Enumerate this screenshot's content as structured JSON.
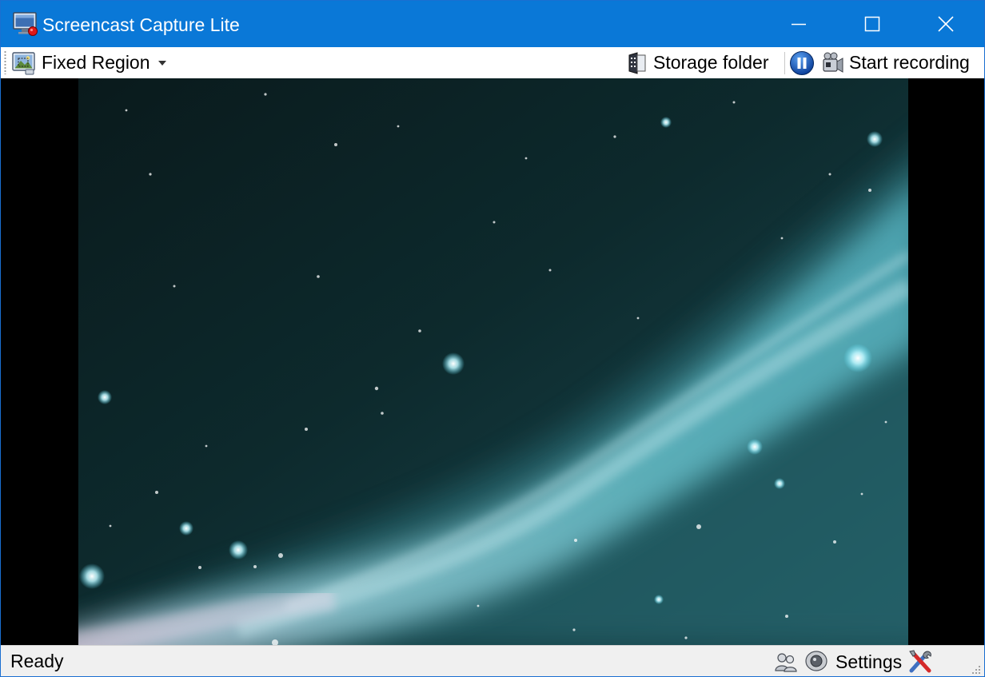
{
  "window": {
    "title": "Screencast Capture Lite",
    "title_icon": "monitor-record-icon",
    "controls": [
      "minimize-icon",
      "maximize-icon",
      "close-icon"
    ]
  },
  "toolbar": {
    "region_mode": {
      "label": "Fixed Region",
      "icon": "region-capture-icon"
    },
    "storage_folder": {
      "label": "Storage folder",
      "icon": "folder-film-icon"
    },
    "pause": {
      "icon": "pause-icon"
    },
    "start_recording": {
      "label": "Start recording",
      "icon": "video-camera-icon"
    }
  },
  "preview": {
    "description_icon": "nebula-preview-image"
  },
  "statusbar": {
    "status": "Ready",
    "settings_label": "Settings",
    "icons": [
      "users-icon",
      "webcam-icon",
      "tools-icon"
    ]
  },
  "colors": {
    "titlebar": "#0a78d7",
    "statusbar": "#f0f0f0",
    "viewport_bg": "#000000"
  }
}
